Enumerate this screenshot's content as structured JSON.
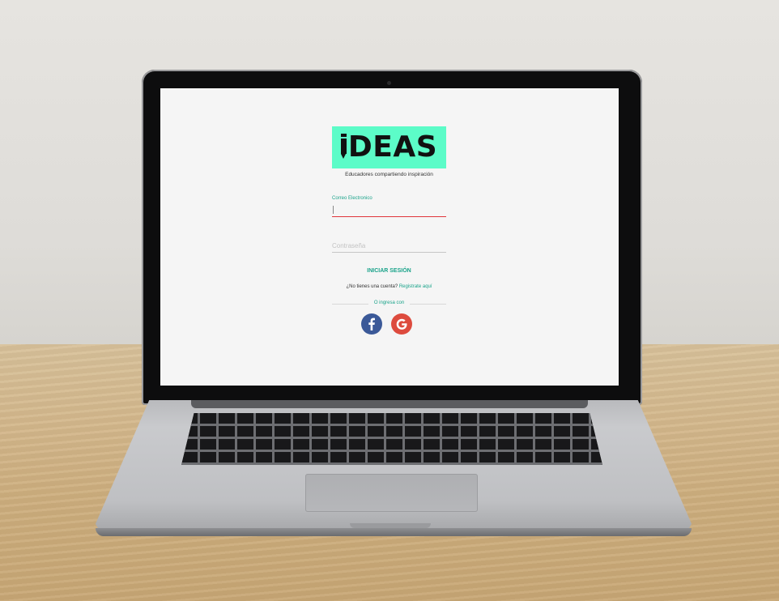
{
  "app": {
    "logo_text": "DEAS",
    "tagline": "Educadores compartiendo inspiración"
  },
  "login_form": {
    "email_label": "Correo Electronico",
    "email_value": "",
    "password_placeholder": "Contraseña",
    "password_value": "",
    "submit_label": "INICIAR SESIÓN",
    "register_prompt": "¿No tienes una cuenta?",
    "register_link": "Registrate aquí",
    "social_divider": "O ingresa con"
  },
  "social": [
    {
      "name": "facebook",
      "icon": "facebook-icon",
      "color": "#3b5998"
    },
    {
      "name": "google",
      "icon": "google-icon",
      "color": "#dd4b3e"
    }
  ],
  "colors": {
    "brand": "#5cfcc8",
    "accent": "#1aa38a",
    "error_underline": "#e0353a"
  }
}
